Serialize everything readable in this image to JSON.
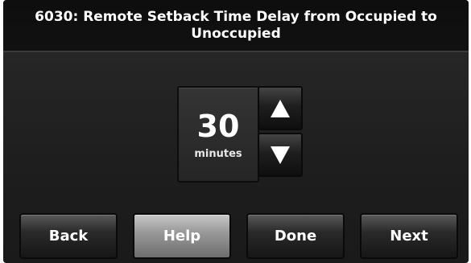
{
  "header": {
    "title": "6030: Remote Setback Time Delay from Occupied to Unoccupied"
  },
  "setting": {
    "value": "30",
    "unit": "minutes",
    "increase_icon": "up-arrow-icon",
    "decrease_icon": "down-arrow-icon"
  },
  "footer": {
    "back_label": "Back",
    "help_label": "Help",
    "done_label": "Done",
    "next_label": "Next"
  }
}
